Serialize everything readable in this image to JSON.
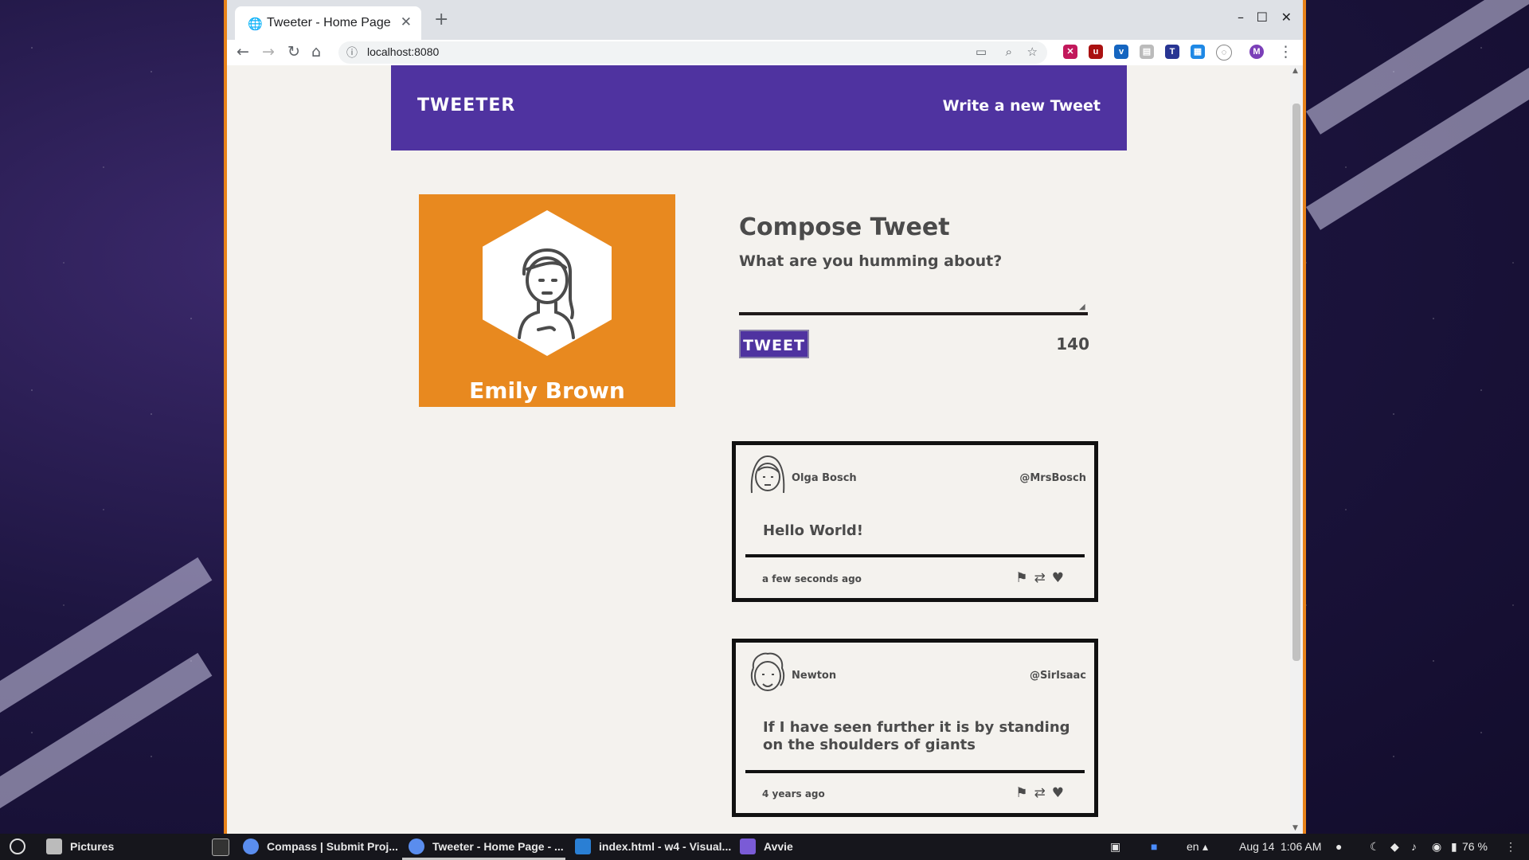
{
  "browser": {
    "tab_title": "Tweeter - Home Page",
    "url": "localhost:8080"
  },
  "page": {
    "brand": "TWEETER",
    "nav_link": "Write a new Tweet",
    "profile": {
      "name": "Emily Brown"
    },
    "compose": {
      "heading": "Compose Tweet",
      "prompt": "What are you humming about?",
      "button": "TWEET",
      "counter": "140"
    },
    "tweets": [
      {
        "name": "Olga Bosch",
        "handle": "@MrsBosch",
        "text": "Hello World!",
        "time": "a few seconds ago"
      },
      {
        "name": "Newton",
        "handle": "@SirIsaac",
        "text": "If I have seen further it is by standing on the shoulders of giants",
        "time": "4 years ago"
      }
    ]
  },
  "taskbar": {
    "items": [
      "Pictures",
      "Compass | Submit Proj...",
      "Tweeter - Home Page - ...",
      "index.html - w4 - Visual...",
      "Avvie"
    ],
    "lang": "en",
    "date": "Aug 14",
    "time": "1:06 AM",
    "battery": "76 %"
  },
  "colors": {
    "nav": "#4f33a0",
    "profile": "#e8891f",
    "background": "#f4f2ee"
  }
}
